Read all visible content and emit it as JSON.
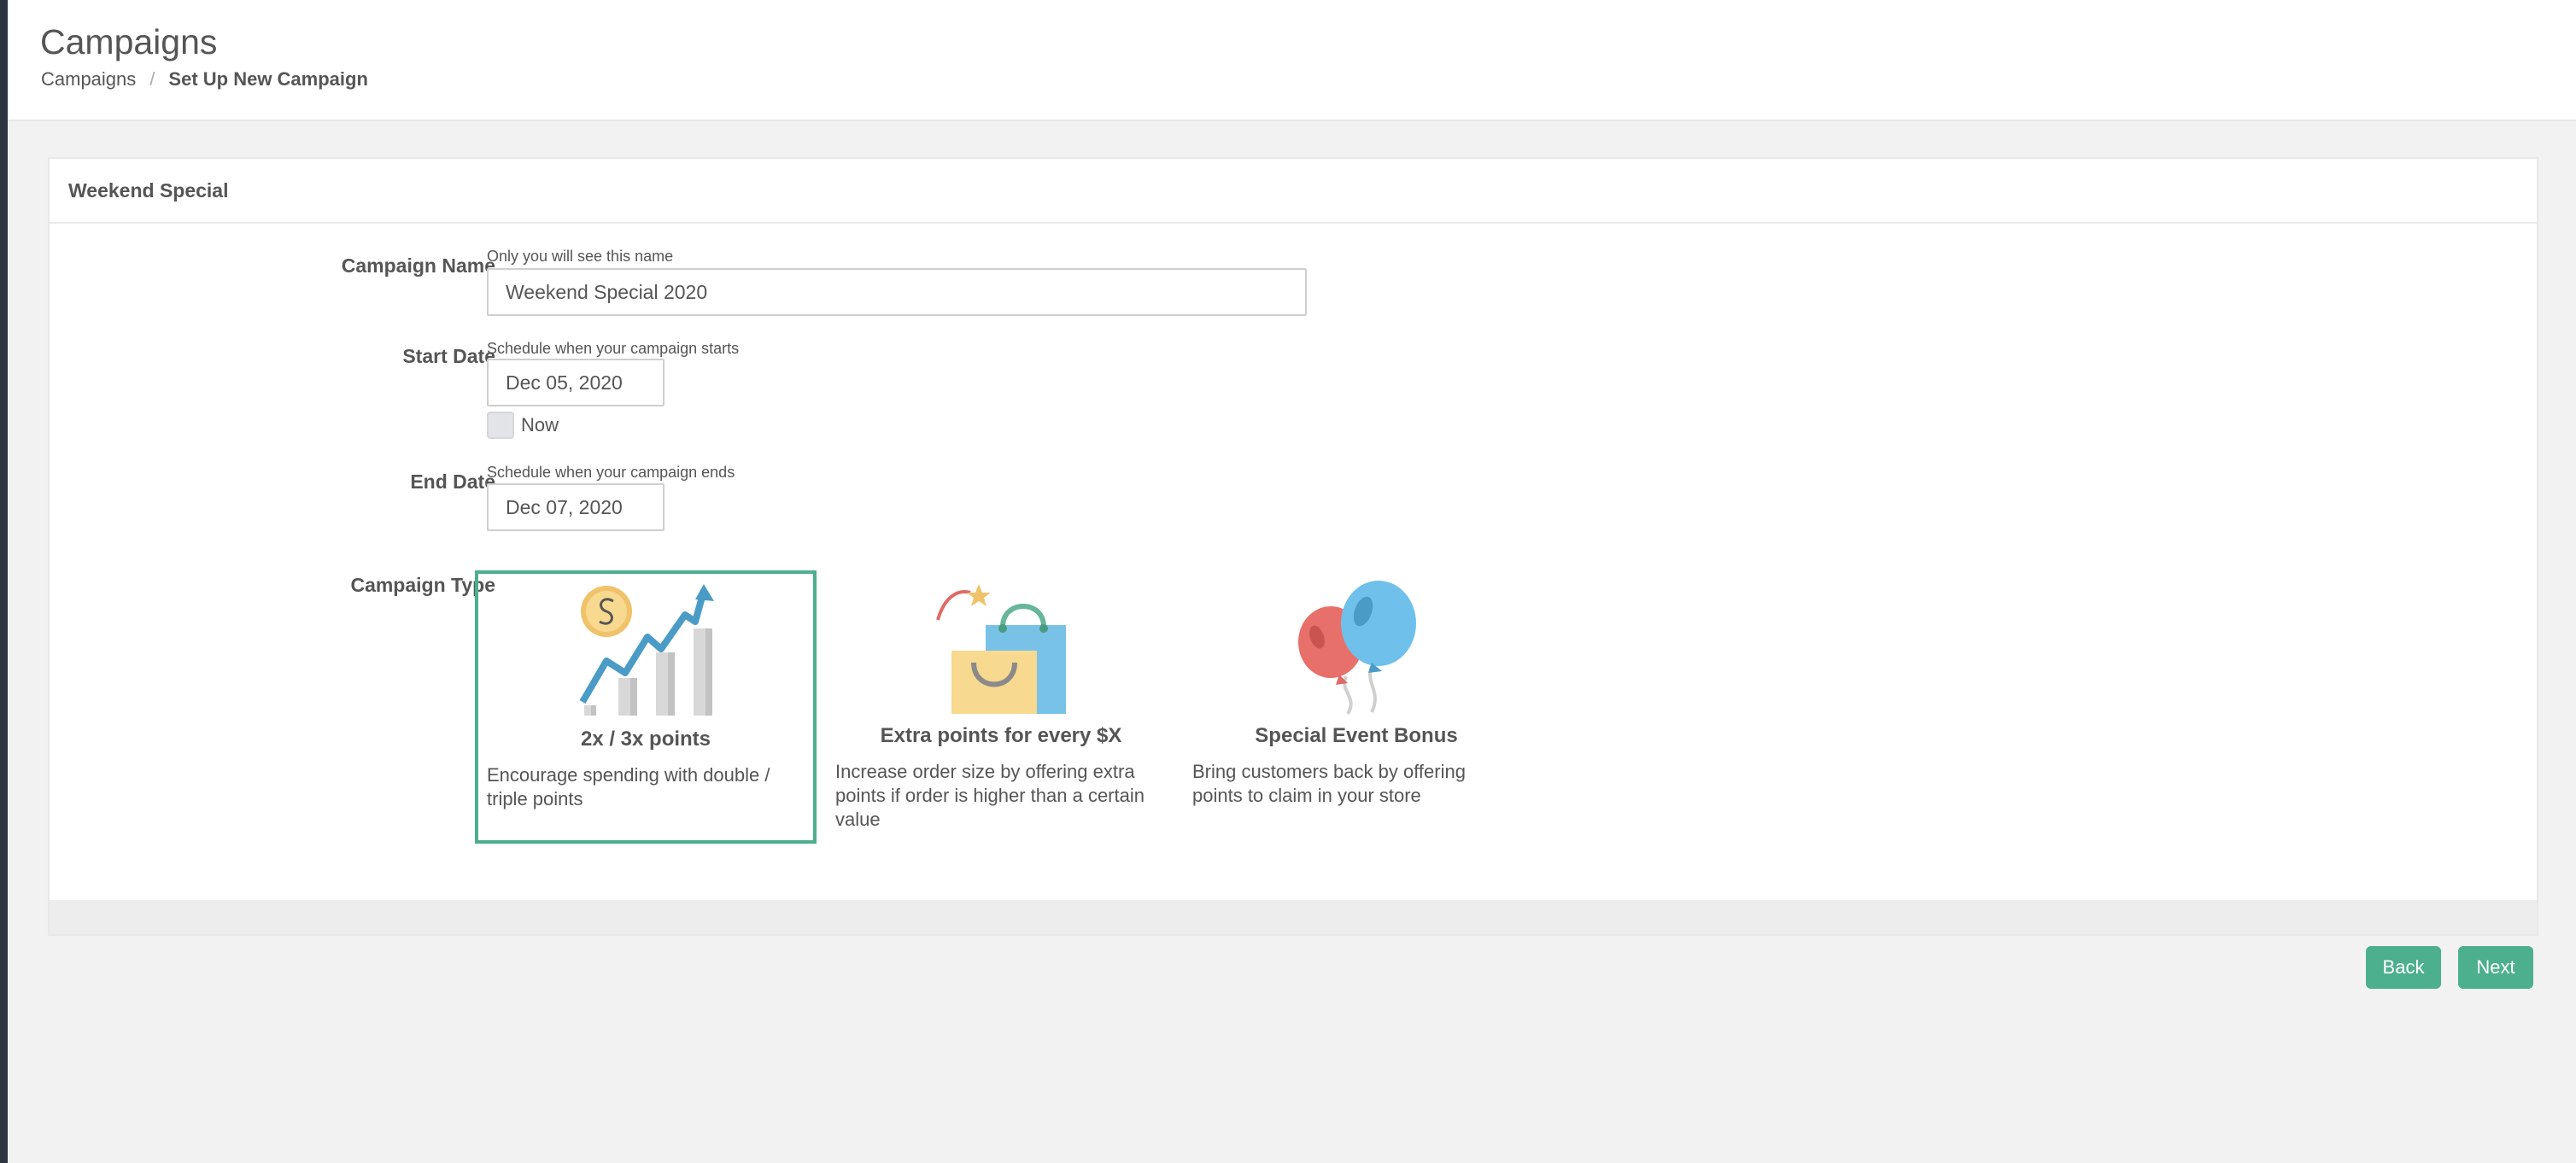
{
  "header": {
    "title": "Campaigns",
    "breadcrumb": {
      "root": "Campaigns",
      "separator": "/",
      "current": "Set Up New Campaign"
    }
  },
  "panel": {
    "title": "Weekend Special",
    "campaign_name": {
      "label": "Campaign Name",
      "help": "Only you will see this name",
      "value": "Weekend Special 2020"
    },
    "start_date": {
      "label": "Start Date",
      "help": "Schedule when your campaign starts",
      "value": "Dec 05, 2020",
      "now_label": "Now",
      "now_checked": false
    },
    "end_date": {
      "label": "End Date",
      "help": "Schedule when your campaign ends",
      "value": "Dec 07, 2020"
    },
    "campaign_type": {
      "label": "Campaign Type",
      "options": [
        {
          "title": "2x / 3x points",
          "description": "Encourage spending with double / triple points",
          "icon": "growth-chart-coin-icon",
          "selected": true
        },
        {
          "title": "Extra points for every $X",
          "description": "Increase order size by offering extra points if order is higher than a certain value",
          "icon": "shopping-bags-icon",
          "selected": false
        },
        {
          "title": "Special Event Bonus",
          "description": "Bring customers back by offering points to claim in your store",
          "icon": "balloons-icon",
          "selected": false
        }
      ]
    }
  },
  "actions": {
    "back_label": "Back",
    "next_label": "Next"
  },
  "colors": {
    "accent": "#4caf8e",
    "sidebar": "#2c3440"
  }
}
